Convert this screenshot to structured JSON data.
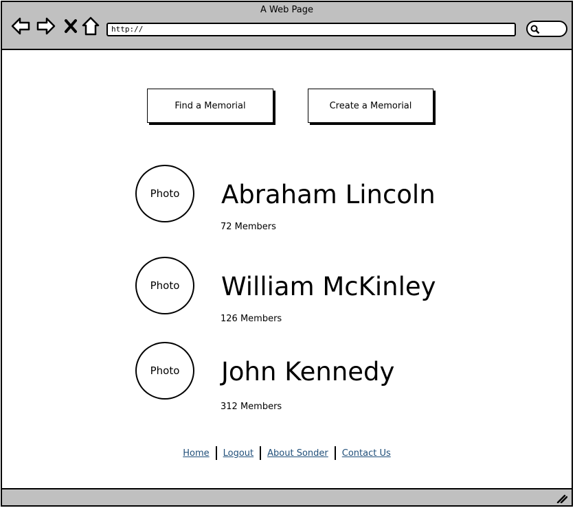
{
  "window": {
    "title": "A Web Page",
    "address": "http://"
  },
  "actions": {
    "find_label": "Find a Memorial",
    "create_label": "Create a Memorial"
  },
  "memorials": [
    {
      "photo_label": "Photo",
      "name": "Abraham Lincoln",
      "members": "72 Members"
    },
    {
      "photo_label": "Photo",
      "name": "William McKinley",
      "members": "126 Members"
    },
    {
      "photo_label": "Photo",
      "name": "John Kennedy",
      "members": "312 Members"
    }
  ],
  "footer": {
    "links": [
      "Home",
      "Logout",
      "About Sonder",
      "Contact Us"
    ]
  },
  "icons": {
    "back": "back-arrow-icon",
    "forward": "forward-arrow-icon",
    "stop": "close-icon",
    "home": "home-icon",
    "search": "search-icon",
    "resize": "resize-grip-icon"
  }
}
